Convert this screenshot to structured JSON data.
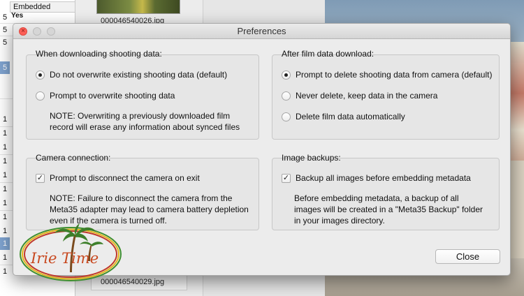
{
  "background": {
    "table_header": "Embedded",
    "table_cell_yes": "Yes",
    "row_digits_top": [
      "5",
      "5",
      "5",
      "5"
    ],
    "row_digits_bottom": [
      "1",
      "1",
      "1",
      "1",
      "1",
      "1",
      "1",
      "1",
      "1",
      "1",
      "1",
      "1"
    ],
    "thumb_label_top": "000046540026.jpg",
    "thumb_label_bottom": "000046540029.jpg"
  },
  "dialog": {
    "title": "Preferences",
    "close_button": "Close",
    "groups": {
      "shooting_data": {
        "title": "When downloading shooting data:",
        "options": [
          {
            "label": "Do not overwrite existing shooting data (default)",
            "selected": true
          },
          {
            "label": "Prompt to overwrite shooting data",
            "selected": false
          }
        ],
        "note_line1": "NOTE: Overwriting a previously downloaded film",
        "note_line2": "record will erase any information about synced files"
      },
      "after_download": {
        "title": "After film data download:",
        "options": [
          {
            "label": "Prompt to delete shooting data from camera (default)",
            "selected": true
          },
          {
            "label": "Never delete, keep data in the camera",
            "selected": false
          },
          {
            "label": "Delete film data automatically",
            "selected": false
          }
        ]
      },
      "camera_connection": {
        "title": "Camera connection:",
        "checkbox": {
          "label": "Prompt to disconnect the camera on exit",
          "checked": true
        },
        "note_line1": "NOTE: Failure to disconnect the camera from the",
        "note_line2": "Meta35 adapter may lead to camera battery depletion",
        "note_line3": "even if the camera is turned off."
      },
      "image_backups": {
        "title": "Image backups:",
        "checkbox": {
          "label": "Backup all images before embedding metadata",
          "checked": true
        },
        "note_line1": "Before embedding metadata, a backup of all",
        "note_line2": "images will be created in a \"Meta35 Backup\" folder",
        "note_line3": "in your images directory."
      }
    }
  },
  "watermark": {
    "text": "Irie Time",
    "colors": {
      "ring_red": "#c0392b",
      "ring_yellow": "#e3b51b",
      "ring_green": "#3f8f2f",
      "text": "#c8481f",
      "palm": "#3d7f2a"
    }
  },
  "colors": {
    "dialog_bg": "#ececec",
    "group_bg": "#e6e6e6",
    "close_light": "#fc5f57",
    "selected_row": "#7fa3cf"
  }
}
